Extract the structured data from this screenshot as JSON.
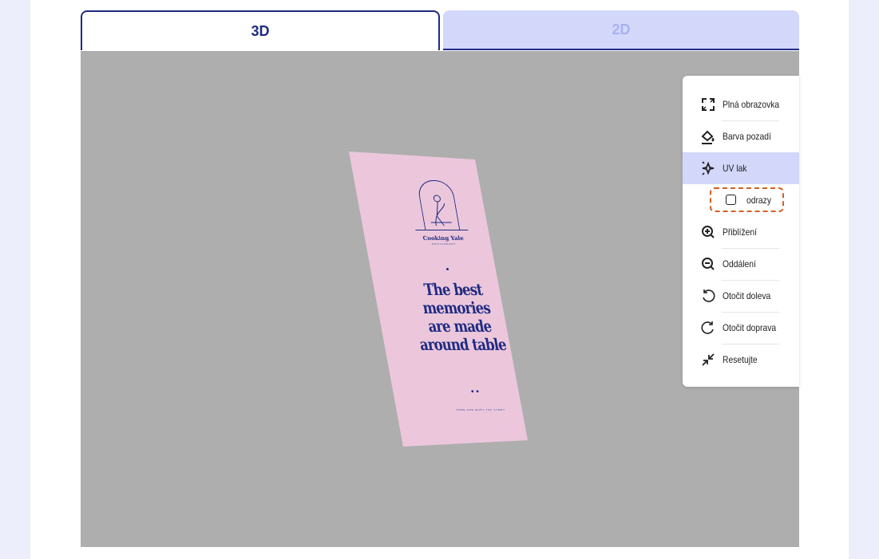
{
  "tabs": {
    "tab_3d": "3D",
    "tab_2d": "2D",
    "active": "3D"
  },
  "poster": {
    "brand": "Cooking Yale",
    "brand_sub": "RESTAURANT",
    "headline_1": "The best",
    "headline_2": "memories",
    "headline_3": "are made",
    "headline_4": "around table",
    "footer": "FOOD AND MUST THE STORY"
  },
  "panel": {
    "fullscreen": "Plná obrazovka",
    "background_color": "Barva pozadí",
    "uv_lak": "UV lak",
    "reflections": "odrazy",
    "reflections_checked": false,
    "zoom_in": "Přiblížení",
    "zoom_out": "Oddálení",
    "rotate_left": "Otočit doleva",
    "rotate_right": "Otočit doprava",
    "reset": "Resetujte"
  },
  "colors": {
    "accent": "#1f2b82",
    "viewer_bg": "#aeaeae",
    "tab_inactive_bg": "#d3d7fa",
    "highlight": "#d45f1f",
    "poster_bg": "#ecc7dc"
  }
}
